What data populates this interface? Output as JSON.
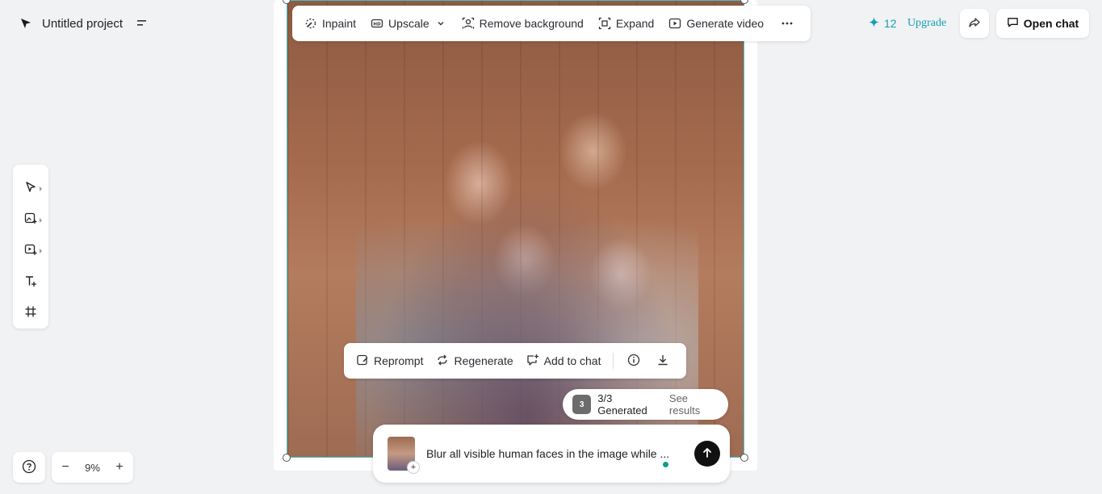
{
  "project": {
    "name": "Untitled project"
  },
  "top_toolbar": {
    "items": [
      {
        "label": "Inpaint",
        "icon": "inpaint-icon"
      },
      {
        "label": "Upscale",
        "icon": "hd-icon"
      },
      {
        "label": "Remove background",
        "icon": "remove-background-icon"
      },
      {
        "label": "Expand",
        "icon": "expand-icon"
      },
      {
        "label": "Generate video",
        "icon": "video-icon"
      }
    ],
    "more_icon": "more-horizontal-icon"
  },
  "header_right": {
    "credits": "12",
    "upgrade_label": "Upgrade",
    "open_chat_label": "Open chat"
  },
  "tools": [
    {
      "name": "select-tool",
      "icon": "cursor-icon"
    },
    {
      "name": "image-tool",
      "icon": "add-image-icon"
    },
    {
      "name": "video-tool",
      "icon": "add-video-icon"
    },
    {
      "name": "text-tool",
      "icon": "text-icon"
    },
    {
      "name": "frame-tool",
      "icon": "frame-icon"
    }
  ],
  "zoom": {
    "level": "9%"
  },
  "result_toolbar": {
    "reprompt_label": "Reprompt",
    "regenerate_label": "Regenerate",
    "add_to_chat_label": "Add to chat"
  },
  "generated": {
    "count": "3",
    "status": "3/3 Generated",
    "see_results": "See results"
  },
  "chat": {
    "text": "Blur all visible human faces in the image while ..."
  },
  "colors": {
    "accent": "#11a2b3",
    "selection_border": "#3ec3c9",
    "background": "#f1f2f4"
  }
}
